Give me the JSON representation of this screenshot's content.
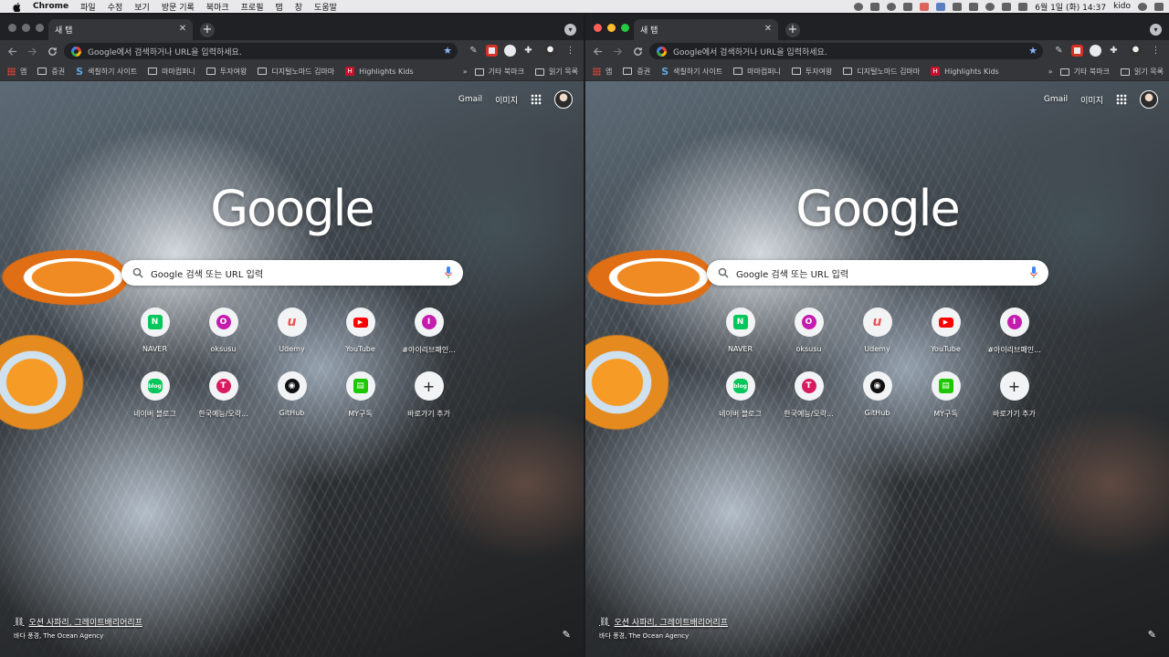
{
  "menubar": {
    "app": "Chrome",
    "items": [
      "파일",
      "수정",
      "보기",
      "방문 기록",
      "북마크",
      "프로필",
      "탭",
      "창",
      "도움말"
    ],
    "clock": "6월 1일 (화)  14:37",
    "user": "kido"
  },
  "windows": [
    {
      "tab_title": "새 탭",
      "omnibox_placeholder": "Google에서 검색하거나 URL을 입력하세요.",
      "bookmarks": {
        "apps": "앱",
        "items": [
          "증권",
          "색칠하기 사이트",
          "마마컴퍼니",
          "투자여왕",
          "디지털노마드 김마마",
          "Highlights Kids"
        ],
        "other": "기타 북마크",
        "reading": "읽기 목록"
      },
      "ntp": {
        "gmail": "Gmail",
        "images": "이미지",
        "logo": "Google",
        "search_placeholder": "Google 검색 또는 URL 입력",
        "shortcuts": [
          {
            "label": "NAVER",
            "icon": "naver-icon"
          },
          {
            "label": "oksusu",
            "icon": "oksusu-icon"
          },
          {
            "label": "Udemy",
            "icon": "udemy-icon"
          },
          {
            "label": "YouTube",
            "icon": "youtube-icon"
          },
          {
            "label": "#아이리브패인...",
            "icon": "instagram-icon"
          },
          {
            "label": "네이버 블로그",
            "icon": "blog-icon"
          },
          {
            "label": "한국예능/오락...",
            "icon": "t-icon"
          },
          {
            "label": "GitHub",
            "icon": "github-icon"
          },
          {
            "label": "MY구독",
            "icon": "subscribe-icon"
          },
          {
            "label": "바로가기 추가",
            "icon": "plus-icon"
          }
        ],
        "credit_title": "오션 사파리, 그레이트배리어리프",
        "credit_author": "바다 풍경, The Ocean Agency"
      }
    },
    {
      "tab_title": "새 탭",
      "omnibox_placeholder": "Google에서 검색하거나 URL을 입력하세요.",
      "bookmarks": {
        "apps": "앱",
        "items": [
          "증권",
          "색칠하기 사이트",
          "마마컴퍼니",
          "투자여왕",
          "디지털노마드 김마마",
          "Highlights Kids"
        ],
        "other": "기타 북마크",
        "reading": "읽기 목록"
      },
      "ntp": {
        "gmail": "Gmail",
        "images": "이미지",
        "logo": "Google",
        "search_placeholder": "Google 검색 또는 URL 입력",
        "shortcuts": [
          {
            "label": "NAVER",
            "icon": "naver-icon"
          },
          {
            "label": "oksusu",
            "icon": "oksusu-icon"
          },
          {
            "label": "Udemy",
            "icon": "udemy-icon"
          },
          {
            "label": "YouTube",
            "icon": "youtube-icon"
          },
          {
            "label": "#아이리브패인...",
            "icon": "instagram-icon"
          },
          {
            "label": "네이버 블로그",
            "icon": "blog-icon"
          },
          {
            "label": "한국예능/오락...",
            "icon": "t-icon"
          },
          {
            "label": "GitHub",
            "icon": "github-icon"
          },
          {
            "label": "MY구독",
            "icon": "subscribe-icon"
          },
          {
            "label": "바로가기 추가",
            "icon": "plus-icon"
          }
        ],
        "credit_title": "오션 사파리, 그레이트배리어리프",
        "credit_author": "바다 풍경, The Ocean Agency"
      }
    }
  ],
  "colors": {
    "chrome_dark": "#202124",
    "toolbar": "#35363a",
    "accent_blue": "#8ab4f8",
    "naver": "#03c75a",
    "youtube": "#ff0000",
    "oksusu": "#c51cb0",
    "udemy": "#ec5252"
  }
}
